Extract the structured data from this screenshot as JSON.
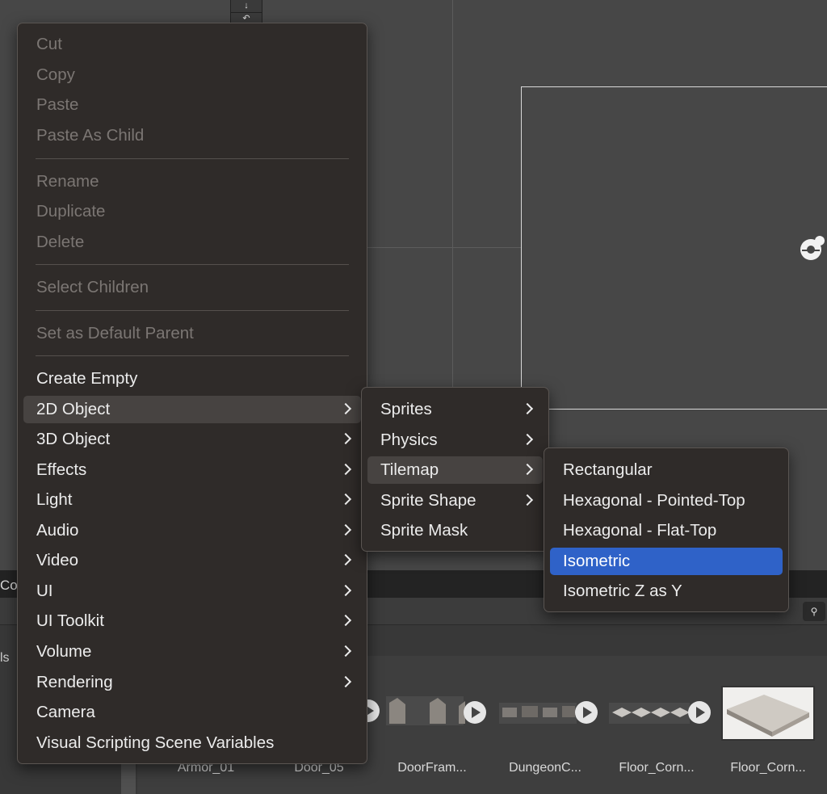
{
  "main_menu": {
    "items": [
      {
        "label": "Cut",
        "disabled": true
      },
      {
        "label": "Copy",
        "disabled": true
      },
      {
        "label": "Paste",
        "disabled": true
      },
      {
        "label": "Paste As Child",
        "disabled": true
      },
      {
        "label": "Rename",
        "disabled": true
      },
      {
        "label": "Duplicate",
        "disabled": true
      },
      {
        "label": "Delete",
        "disabled": true
      },
      {
        "label": "Select Children",
        "disabled": true
      },
      {
        "label": "Set as Default Parent",
        "disabled": true
      },
      {
        "label": "Create Empty",
        "disabled": false
      },
      {
        "label": "2D Object",
        "disabled": false,
        "submenu": true,
        "active": true
      },
      {
        "label": "3D Object",
        "disabled": false,
        "submenu": true
      },
      {
        "label": "Effects",
        "disabled": false,
        "submenu": true
      },
      {
        "label": "Light",
        "disabled": false,
        "submenu": true
      },
      {
        "label": "Audio",
        "disabled": false,
        "submenu": true
      },
      {
        "label": "Video",
        "disabled": false,
        "submenu": true
      },
      {
        "label": "UI",
        "disabled": false,
        "submenu": true
      },
      {
        "label": "UI Toolkit",
        "disabled": false,
        "submenu": true
      },
      {
        "label": "Volume",
        "disabled": false,
        "submenu": true
      },
      {
        "label": "Rendering",
        "disabled": false,
        "submenu": true
      },
      {
        "label": "Camera",
        "disabled": false
      },
      {
        "label": "Visual Scripting Scene Variables",
        "disabled": false
      }
    ]
  },
  "submenu_2d": {
    "items": [
      {
        "label": "Sprites",
        "submenu": true
      },
      {
        "label": "Physics",
        "submenu": true
      },
      {
        "label": "Tilemap",
        "submenu": true,
        "active": true
      },
      {
        "label": "Sprite Shape",
        "submenu": true
      },
      {
        "label": "Sprite Mask",
        "submenu": false
      }
    ]
  },
  "submenu_tilemap": {
    "items": [
      {
        "label": "Rectangular"
      },
      {
        "label": "Hexagonal - Pointed-Top"
      },
      {
        "label": "Hexagonal - Flat-Top"
      },
      {
        "label": "Isometric",
        "selected": true
      },
      {
        "label": "Isometric Z as Y"
      }
    ]
  },
  "background": {
    "panel_tab_label": "Co",
    "side_label": "ls",
    "assets": [
      {
        "name": "Armor_01"
      },
      {
        "name": "Door_05"
      },
      {
        "name": "DoorFram..."
      },
      {
        "name": "DungeonC..."
      },
      {
        "name": "Floor_Corn..."
      },
      {
        "name": "Floor_Corn..."
      }
    ]
  },
  "colors": {
    "menu_bg": "#2f2b29",
    "selected_accent": "#2f62c8",
    "disabled_text": "#7b7673"
  }
}
